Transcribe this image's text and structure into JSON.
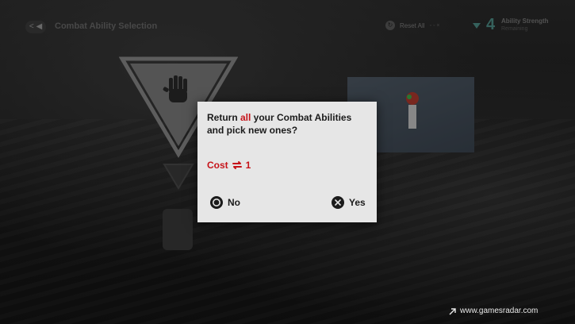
{
  "header": {
    "back_chip": "< ◀",
    "title": "Combat Ability Selection",
    "reset_label": "Reset All",
    "reset_hint": "◦ ◦ ×",
    "ability_count": "4",
    "ability_label": "Ability Strength",
    "ability_sub": "Remaining"
  },
  "dialog": {
    "message_prefix": "Return ",
    "message_highlight": "all",
    "message_suffix": " your Combat Abilities and pick new ones?",
    "cost_label": "Cost",
    "cost_value": "1",
    "no_label": "No",
    "yes_label": "Yes"
  },
  "watermark": "www.gamesradar.com",
  "colors": {
    "accent_red": "#c6141a",
    "dialog_bg": "#e6e6e6",
    "ability_teal": "#4f8f88"
  },
  "icons": {
    "emblem": "stop-hand-icon",
    "cost": "exchange-icon",
    "no": "circle-button-icon",
    "yes": "cross-button-icon"
  }
}
